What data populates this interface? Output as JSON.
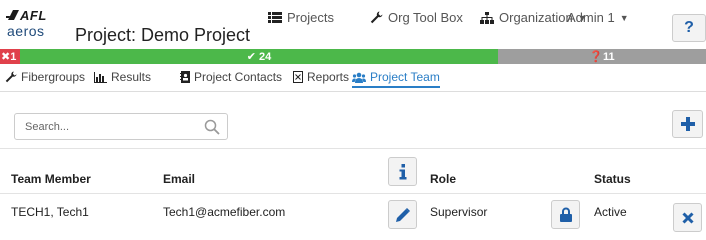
{
  "logo": {
    "brand": "AFL",
    "product": "aeros"
  },
  "project": {
    "title": "Project: Demo Project"
  },
  "nav": {
    "projects": "Projects",
    "org_tool_box": "Org Tool Box",
    "organization": "Organization",
    "admin": "Admin 1",
    "help": "?"
  },
  "status": {
    "failed": "1",
    "passed": "24",
    "unknown": "11"
  },
  "tabs": [
    {
      "label": "Fibergroups",
      "icon": "wrench-icon"
    },
    {
      "label": "Results",
      "icon": "bar-chart-icon"
    },
    {
      "label": "Project Contacts",
      "icon": "address-book-icon"
    },
    {
      "label": "Reports",
      "icon": "report-icon"
    },
    {
      "label": "Project Team",
      "icon": "users-icon",
      "active": true
    }
  ],
  "search": {
    "placeholder": "Search..."
  },
  "table": {
    "headers": {
      "member": "Team Member",
      "email": "Email",
      "role": "Role",
      "status": "Status"
    },
    "rows": [
      {
        "member": "TECH1, Tech1",
        "email": "Tech1@acmefiber.com",
        "role": "Supervisor",
        "status": "Active"
      }
    ]
  },
  "colors": {
    "fail": "#e0414b",
    "pass": "#4cb84a",
    "unknown": "#9e9e9e",
    "accent": "#2a7ec6",
    "icon_blue": "#1f5fa8"
  }
}
